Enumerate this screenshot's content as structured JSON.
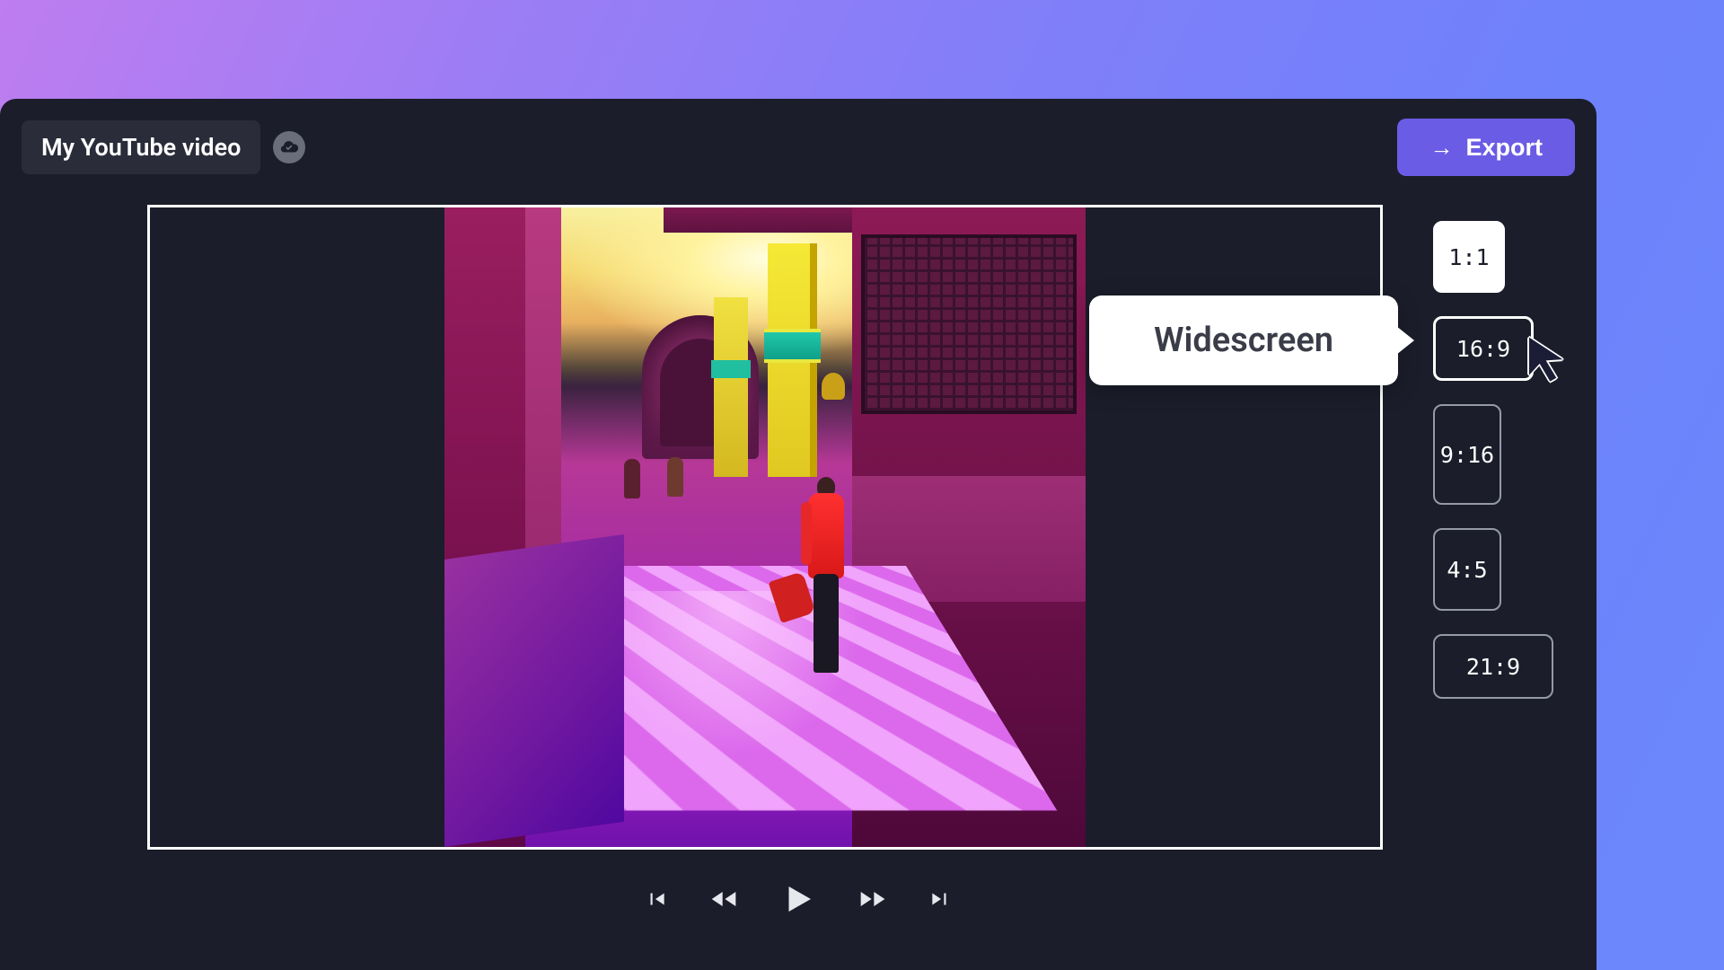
{
  "header": {
    "project_title": "My YouTube video",
    "export_label": "Export"
  },
  "tooltip": {
    "label": "Widescreen"
  },
  "aspect_ratios": [
    {
      "label": "1:1",
      "filled": true,
      "selected": false,
      "cls": "r-11"
    },
    {
      "label": "16:9",
      "filled": false,
      "selected": true,
      "cls": "r-169"
    },
    {
      "label": "9:16",
      "filled": false,
      "selected": false,
      "cls": "r-916"
    },
    {
      "label": "4:5",
      "filled": false,
      "selected": false,
      "cls": "r-45"
    },
    {
      "label": "21:9",
      "filled": false,
      "selected": false,
      "cls": "r-219"
    }
  ],
  "controls": {
    "skip_start": "skip-start",
    "rewind": "rewind",
    "play": "play",
    "forward": "forward",
    "skip_end": "skip-end"
  }
}
